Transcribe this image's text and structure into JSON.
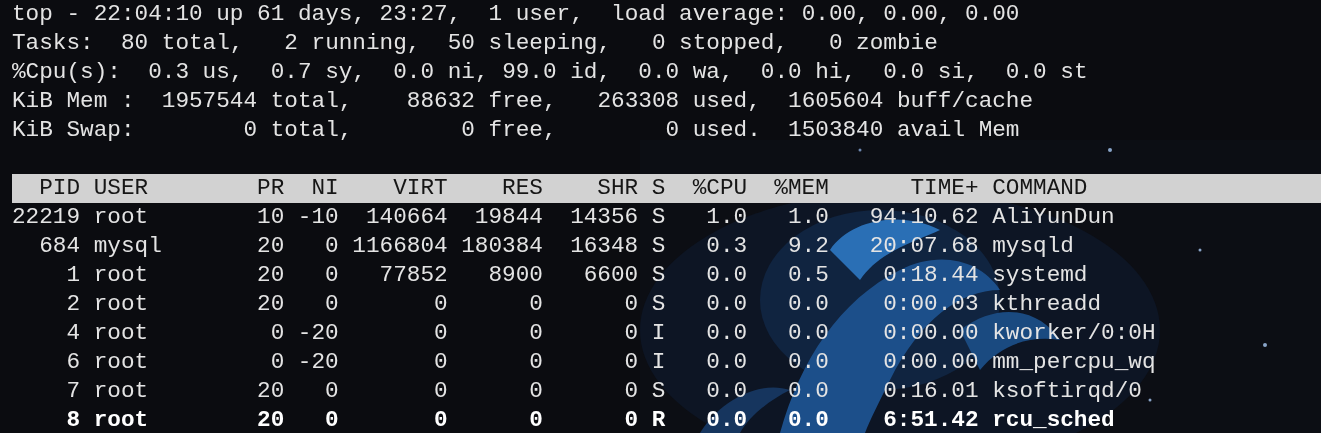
{
  "summary": [
    "top - 22:04:10 up 61 days, 23:27,  1 user,  load average: 0.00, 0.00, 0.00",
    "Tasks:  80 total,   2 running,  50 sleeping,   0 stopped,   0 zombie",
    "%Cpu(s):  0.3 us,  0.7 sy,  0.0 ni, 99.0 id,  0.0 wa,  0.0 hi,  0.0 si,  0.0 st",
    "KiB Mem :  1957544 total,    88632 free,   263308 used,  1605604 buff/cache",
    "KiB Swap:        0 total,        0 free,        0 used.  1503840 avail Mem"
  ],
  "table": {
    "columns": [
      "PID",
      "USER",
      "PR",
      "NI",
      "VIRT",
      "RES",
      "SHR",
      "S",
      "%CPU",
      "%MEM",
      "TIME+",
      "COMMAND"
    ],
    "rows": [
      {
        "cells": [
          "22219",
          "root",
          "10",
          "-10",
          "140664",
          "19844",
          "14356",
          "S",
          "1.0",
          "1.0",
          "94:10.62",
          "AliYunDun"
        ],
        "highlighted": false
      },
      {
        "cells": [
          "684",
          "mysql",
          "20",
          "0",
          "1166804",
          "180384",
          "16348",
          "S",
          "0.3",
          "9.2",
          "20:07.68",
          "mysqld"
        ],
        "highlighted": false
      },
      {
        "cells": [
          "1",
          "root",
          "20",
          "0",
          "77852",
          "8900",
          "6600",
          "S",
          "0.0",
          "0.5",
          "0:18.44",
          "systemd"
        ],
        "highlighted": false
      },
      {
        "cells": [
          "2",
          "root",
          "20",
          "0",
          "0",
          "0",
          "0",
          "S",
          "0.0",
          "0.0",
          "0:00.03",
          "kthreadd"
        ],
        "highlighted": false
      },
      {
        "cells": [
          "4",
          "root",
          "0",
          "-20",
          "0",
          "0",
          "0",
          "I",
          "0.0",
          "0.0",
          "0:00.00",
          "kworker/0:0H"
        ],
        "highlighted": false
      },
      {
        "cells": [
          "6",
          "root",
          "0",
          "-20",
          "0",
          "0",
          "0",
          "I",
          "0.0",
          "0.0",
          "0:00.00",
          "mm_percpu_wq"
        ],
        "highlighted": false
      },
      {
        "cells": [
          "7",
          "root",
          "20",
          "0",
          "0",
          "0",
          "0",
          "S",
          "0.0",
          "0.0",
          "0:16.01",
          "ksoftirqd/0"
        ],
        "highlighted": false
      },
      {
        "cells": [
          "8",
          "root",
          "20",
          "0",
          "0",
          "0",
          "0",
          "R",
          "0.0",
          "0.0",
          "6:51.42",
          "rcu_sched"
        ],
        "highlighted": true
      }
    ]
  }
}
